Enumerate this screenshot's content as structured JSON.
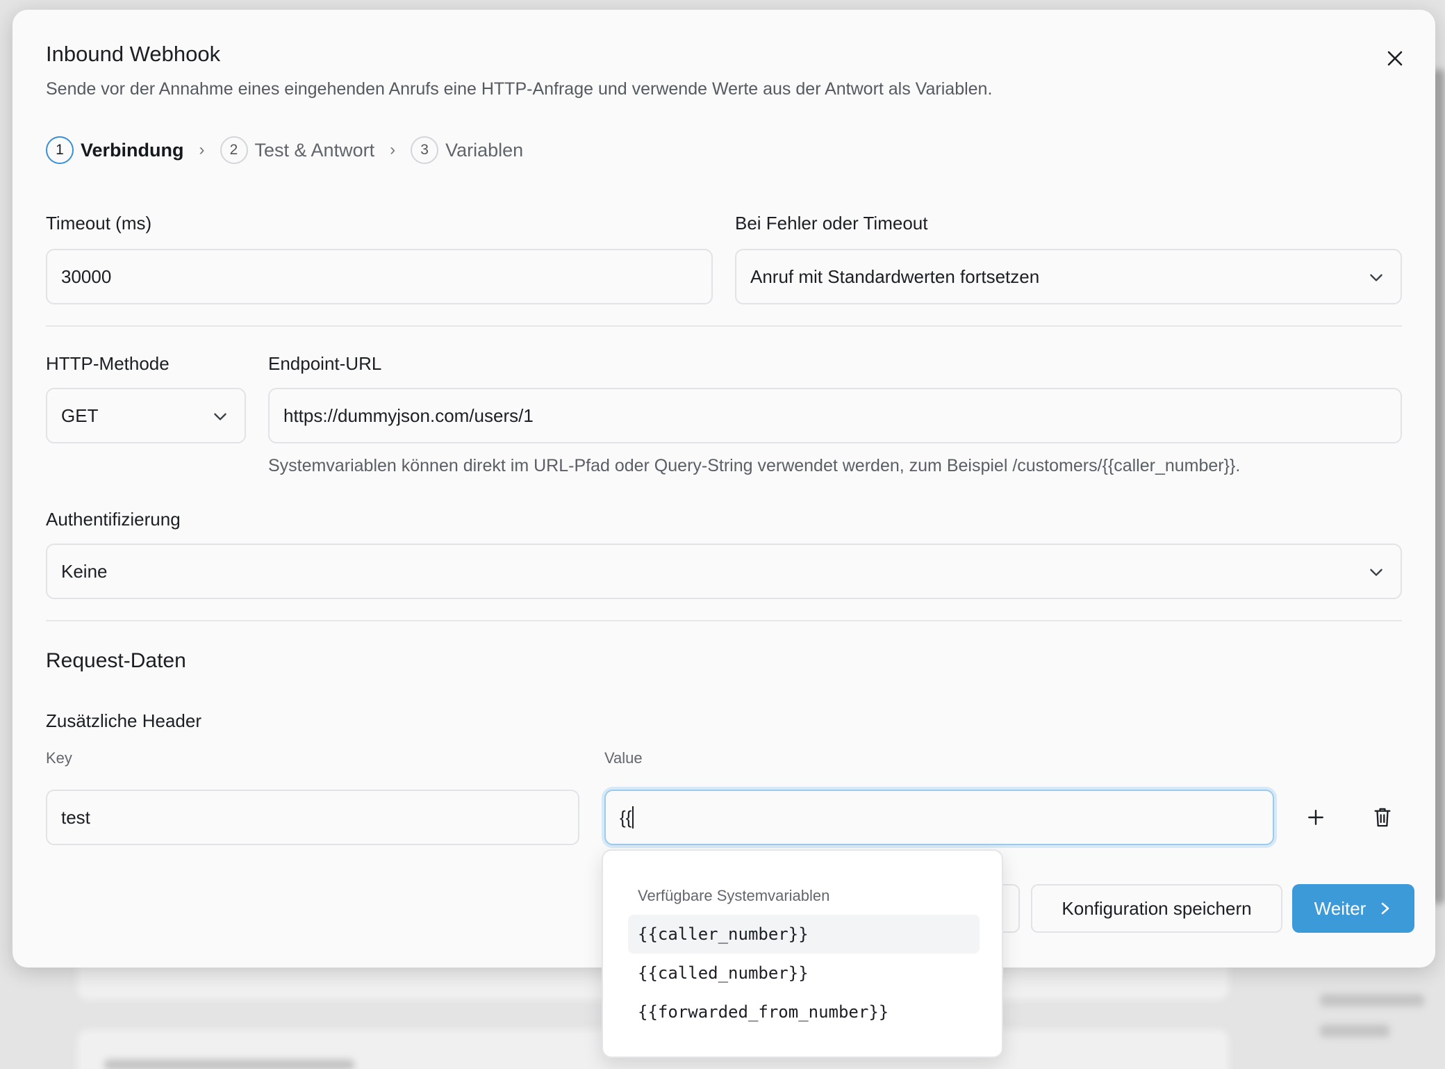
{
  "dialog": {
    "title": "Inbound Webhook",
    "subtitle": "Sende vor der Annahme eines eingehenden Anrufs eine HTTP-Anfrage und verwende Werte aus der Antwort als Variablen.",
    "close_icon": "close-icon"
  },
  "steps": [
    {
      "num": "1",
      "label": "Verbindung",
      "active": true
    },
    {
      "num": "2",
      "label": "Test & Antwort",
      "active": false
    },
    {
      "num": "3",
      "label": "Variablen",
      "active": false
    }
  ],
  "steps_separator": "›",
  "timeout": {
    "label": "Timeout (ms)",
    "value": "30000"
  },
  "on_error": {
    "label": "Bei Fehler oder Timeout",
    "value": "Anruf mit Standardwerten fortsetzen"
  },
  "http_method": {
    "label": "HTTP-Methode",
    "value": "GET"
  },
  "endpoint": {
    "label": "Endpoint-URL",
    "value": "https://dummyjson.com/users/1",
    "hint": "Systemvariablen können direkt im URL-Pfad oder Query-String verwendet werden, zum Beispiel /customers/{{caller_number}}."
  },
  "auth": {
    "label": "Authentifizierung",
    "value": "Keine"
  },
  "request_data": {
    "title": "Request-Daten",
    "headers_title": "Zusätzliche Header",
    "key_label": "Key",
    "value_label": "Value",
    "row": {
      "key": "test",
      "value": "{{"
    }
  },
  "suggestions": {
    "header": "Verfügbare Systemvariablen",
    "items": [
      "{{caller_number}}",
      "{{called_number}}",
      "{{forwarded_from_number}}"
    ]
  },
  "footer": {
    "save_label": "Konfiguration speichern",
    "next_label": "Weiter"
  },
  "colors": {
    "accent": "#3d9ad9",
    "focus_ring": "#9fcbea"
  }
}
